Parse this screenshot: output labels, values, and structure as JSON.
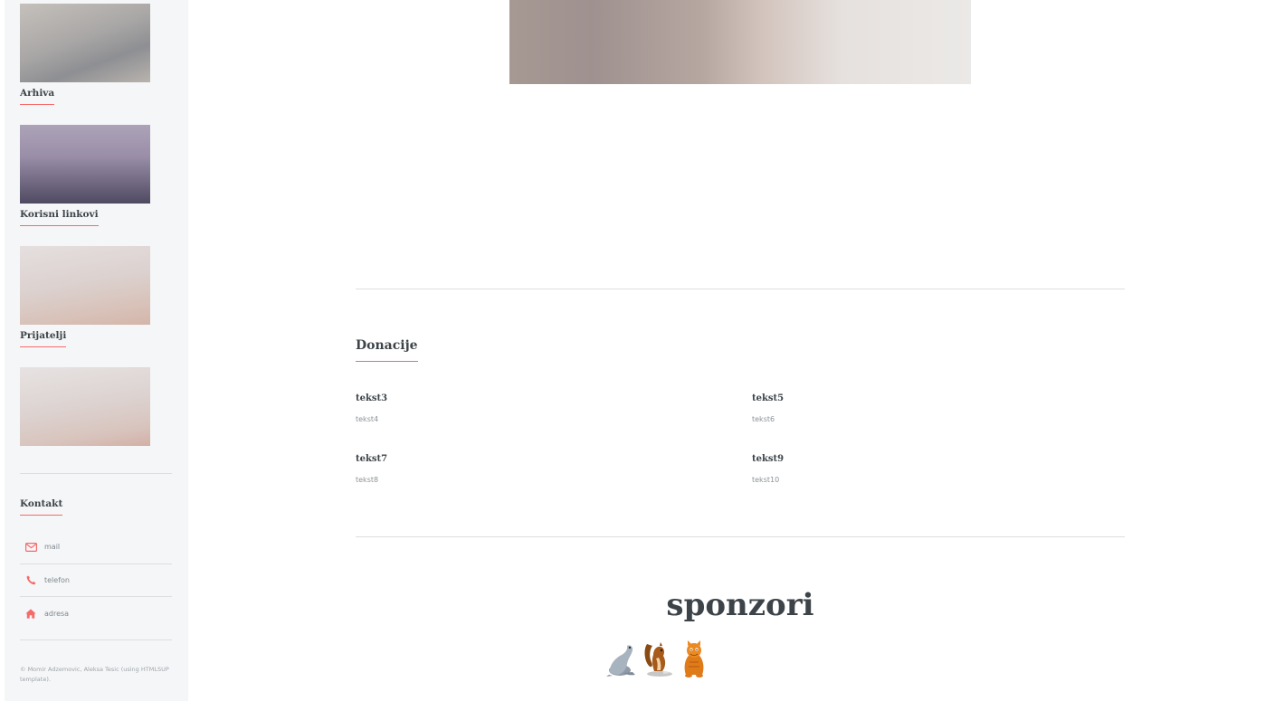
{
  "sidebar": {
    "mini_posts": [
      {
        "label": "Arhiva"
      },
      {
        "label": "Korisni linkovi"
      },
      {
        "label": "Prijatelji"
      },
      {
        "label": ""
      }
    ],
    "contact": {
      "heading": "Kontakt",
      "items": [
        {
          "icon": "envelope-icon",
          "label": "mail"
        },
        {
          "icon": "phone-icon",
          "label": "telefon"
        },
        {
          "icon": "home-icon",
          "label": "adresa"
        }
      ]
    },
    "copyright": "© Momir Adzemovic, Aleksa Tesic (using HTMLSUP template)."
  },
  "main": {
    "donations": {
      "title": "Donacije",
      "features": [
        {
          "title": "tekst3",
          "text": "tekst4"
        },
        {
          "title": "tekst5",
          "text": "tekst6"
        },
        {
          "title": "tekst7",
          "text": "tekst8"
        },
        {
          "title": "tekst9",
          "text": "tekst10"
        }
      ]
    },
    "sponsors": {
      "heading": "sponzori",
      "logos": [
        "seal-icon",
        "squirrel-icon",
        "cat-icon"
      ]
    }
  },
  "colors": {
    "accent": "#f56a6a",
    "text": "#3d4449",
    "sidebar_bg": "#f5f6f7",
    "muted": "#7f888f"
  }
}
